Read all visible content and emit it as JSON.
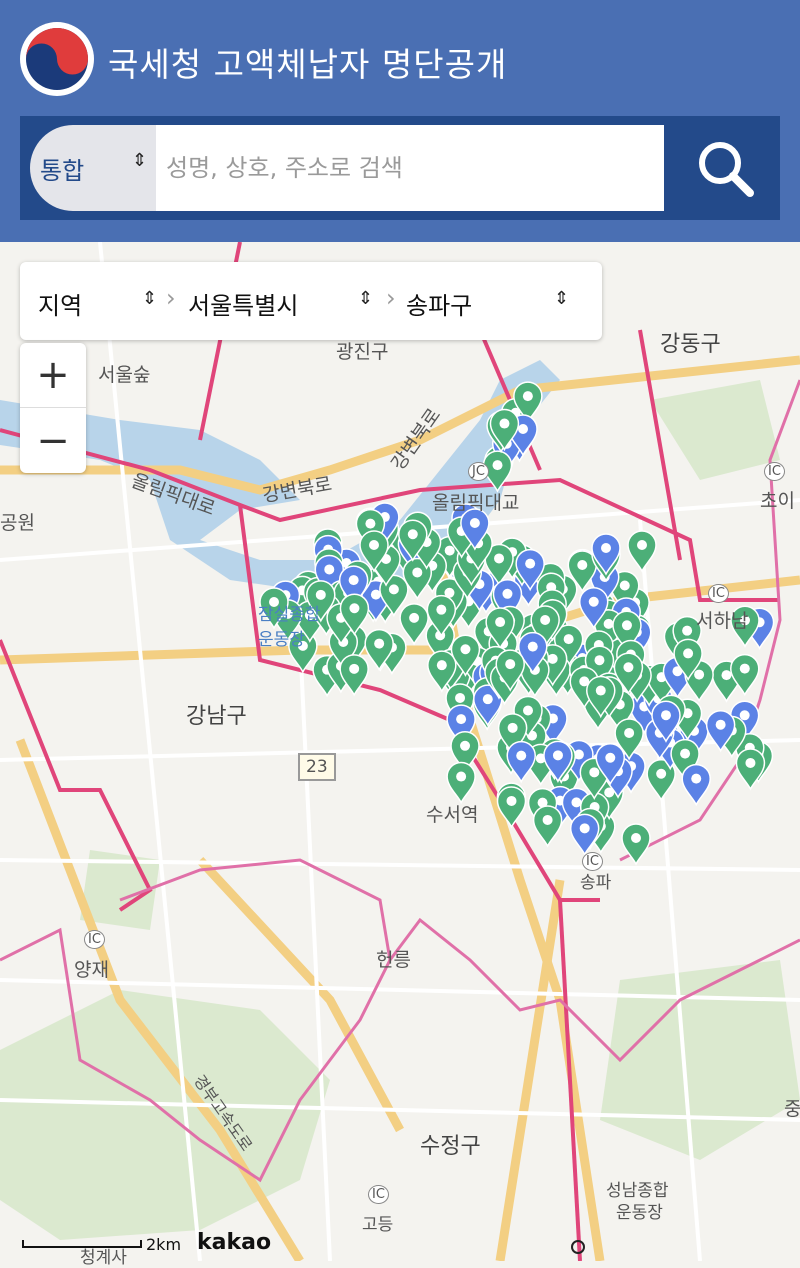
{
  "header": {
    "title": "국세청 고액체납자 명단공개",
    "logo_icon": "taegeuk-logo-icon",
    "bg_color": "#4a6fb3"
  },
  "search": {
    "scope_value": "통합",
    "placeholder": "성명, 상호, 주소로 검색",
    "button_icon": "search-icon"
  },
  "region_filter": {
    "level1": "지역",
    "level2": "서울특별시",
    "level3": "송파구"
  },
  "zoom": {
    "in": "+",
    "out": "−"
  },
  "map": {
    "labels": {
      "gwangjin": "광진구",
      "gangdong": "강동구",
      "seoul_forest": "서울숲",
      "gangbyeon1": "강변북로",
      "gangbyeon2": "강변북로",
      "olympic_daero": "올림픽대로",
      "olympic_bridge": "올림픽대교",
      "stadium": "잠실종합운동장",
      "gangnam": "강남구",
      "route": "23",
      "suseo": "수서역",
      "songpa": "송파",
      "seohanam": "서하남",
      "choi": "초이",
      "park": "공원",
      "yangjae": "양재",
      "heolleung": "헌릉",
      "expressway": "경부고속도로",
      "sujeong": "수정구",
      "seongnam_stadium_1": "성남종합",
      "seongnam_stadium_2": "운동장",
      "godeung": "고등",
      "cheonggyesa": "청계사",
      "jun": "중",
      "ic": "IC",
      "jc": "JC"
    },
    "scale": "2km",
    "attribution": "kakao",
    "marker_colors": {
      "green": "#4caf78",
      "blue": "#5b82e6"
    }
  }
}
